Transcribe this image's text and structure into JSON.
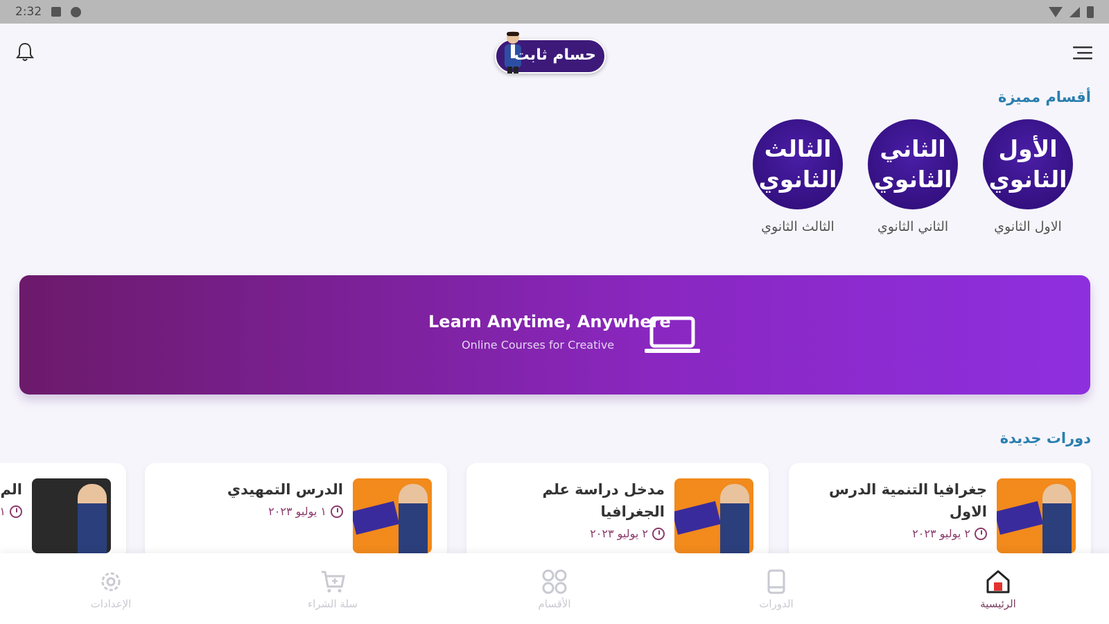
{
  "status_bar": {
    "time": "2:32"
  },
  "header": {
    "logo_text": "حسام ثابت"
  },
  "featured": {
    "title": "أقسام مميزة",
    "items": [
      {
        "circle_line1": "الأول",
        "circle_line2": "الثانوي",
        "label": "الاول الثانوي"
      },
      {
        "circle_line1": "الثاني",
        "circle_line2": "الثانوي",
        "label": "الثاني الثانوي"
      },
      {
        "circle_line1": "الثالث",
        "circle_line2": "الثانوي",
        "label": "الثالث الثانوي"
      }
    ]
  },
  "banner": {
    "title": "Learn Anytime, Anywhere",
    "subtitle": "Online Courses for Creative"
  },
  "new_courses": {
    "title": "دورات جديدة",
    "items": [
      {
        "title": "جغرافيا التنمية الدرس الاول",
        "date": "٢ يوليو ٢٠٢٣"
      },
      {
        "title": "مدخل دراسة علم الجغرافيا",
        "date": "٢ يوليو ٢٠٢٣"
      },
      {
        "title": "الدرس التمهيدي",
        "date": "١ يوليو ٢٠٢٣"
      },
      {
        "title": "الم",
        "date": "١"
      }
    ]
  },
  "bottom_nav": {
    "items": [
      {
        "label": "الإعدادات",
        "icon": "gear-icon"
      },
      {
        "label": "سلة الشراء",
        "icon": "cart-icon"
      },
      {
        "label": "الأقسام",
        "icon": "grid-icon"
      },
      {
        "label": "الدورات",
        "icon": "book-icon"
      },
      {
        "label": "الرئيسية",
        "icon": "home-icon",
        "active": true
      }
    ]
  }
}
